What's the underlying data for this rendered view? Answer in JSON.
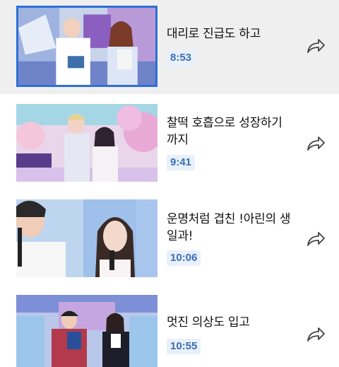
{
  "videos": [
    {
      "title": "대리로 진급도 하고",
      "duration": "8:53",
      "active": true
    },
    {
      "title": "찰떡 호흡으로 성장하기 까지",
      "duration": "9:41",
      "active": false
    },
    {
      "title": "운명처럼 겹친 !아린의 생일과!",
      "duration": "10:06",
      "active": false
    },
    {
      "title": "멋진 의상도 입고",
      "duration": "10:55",
      "active": false
    }
  ],
  "icons": {
    "share": "share-arrow-icon"
  },
  "colors": {
    "active_border": "#2f6fd6",
    "active_bg": "#efefef",
    "duration_bg": "#e8f0fb",
    "duration_text": "#3a6fb3"
  }
}
